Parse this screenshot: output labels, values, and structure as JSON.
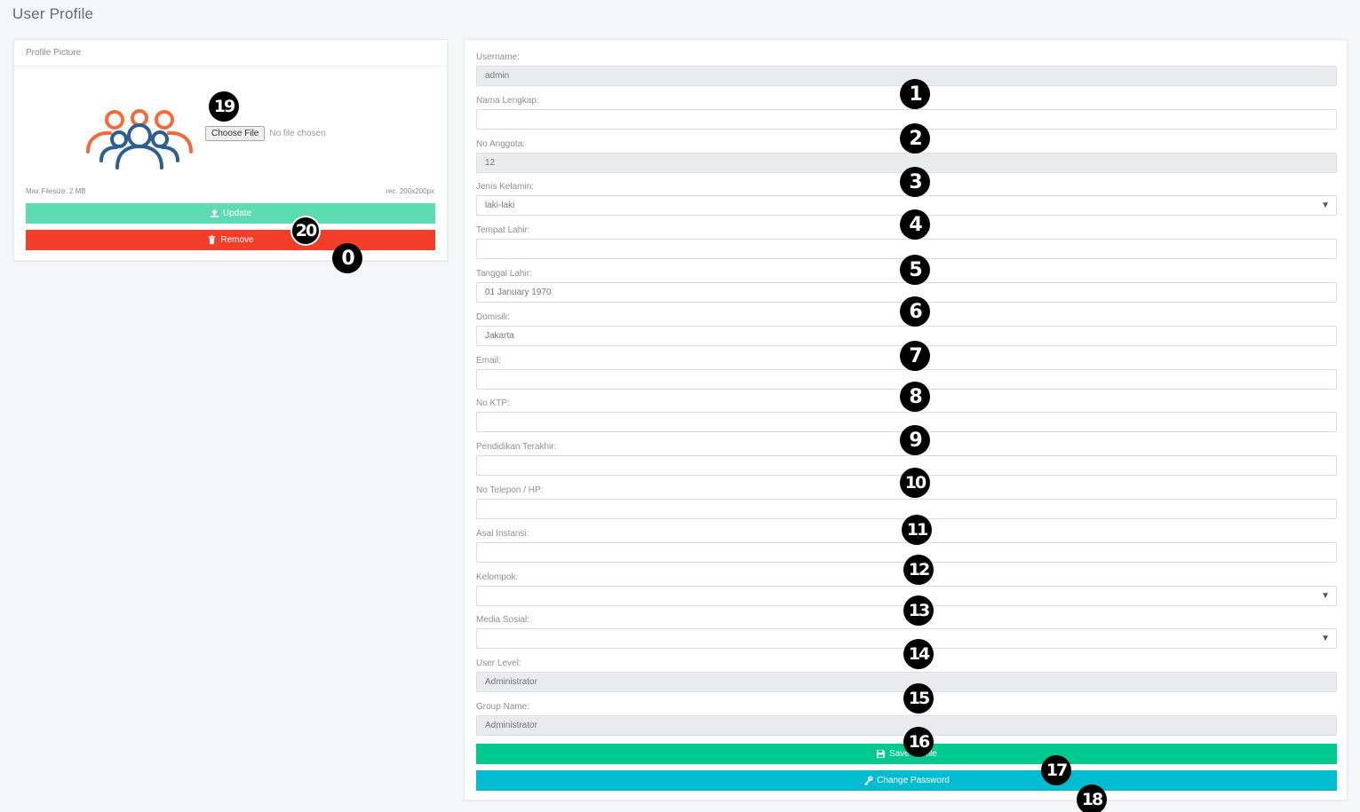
{
  "page": {
    "title": "User Profile"
  },
  "profile_picture": {
    "header": "Profile Picture",
    "file_button": "Choose File",
    "file_status": "No file chosen",
    "max_filesize": "Max Filesize: 2 MB",
    "recommended": "rec. 200x200px",
    "update_label": "Update",
    "remove_label": "Remove"
  },
  "form": {
    "fields": [
      {
        "label": "Username:",
        "value": "admin",
        "readonly": true
      },
      {
        "label": "Nama Lengkap:",
        "value": ""
      },
      {
        "label": "No Anggota:",
        "value": "12",
        "readonly": true
      },
      {
        "label": "Jenis Kelamin:",
        "value": "laki-laki",
        "select": true
      },
      {
        "label": "Tempat Lahir:",
        "value": ""
      },
      {
        "label": "Tanggal Lahir:",
        "value": "01 January 1970"
      },
      {
        "label": "Domisili:",
        "value": "Jakarta"
      },
      {
        "label": "Email:",
        "value": ""
      },
      {
        "label": "No KTP:",
        "value": ""
      },
      {
        "label": "Pendidikan Terakhir:",
        "value": ""
      },
      {
        "label": "No Telepon / HP:",
        "value": ""
      },
      {
        "label": "Asal Instansi:",
        "value": ""
      },
      {
        "label": "Kelompok:",
        "value": "",
        "select": true
      },
      {
        "label": "Media Sosial:",
        "value": "",
        "select": true
      },
      {
        "label": "User Level:",
        "value": "Administrator",
        "readonly": true
      },
      {
        "label": "Group Name:",
        "value": "Administrator",
        "readonly": true
      }
    ],
    "save_label": "Save Profile",
    "change_password_label": "Change Password"
  },
  "markers": [
    "0",
    "1",
    "2",
    "3",
    "4",
    "5",
    "6",
    "7",
    "8",
    "9",
    "10",
    "11",
    "12",
    "13",
    "14",
    "15",
    "16",
    "17",
    "18",
    "19",
    "20"
  ],
  "colors": {
    "update": "#5ddbb3",
    "remove": "#f43d2b",
    "save": "#00c990",
    "change_password": "#00bcd0"
  }
}
